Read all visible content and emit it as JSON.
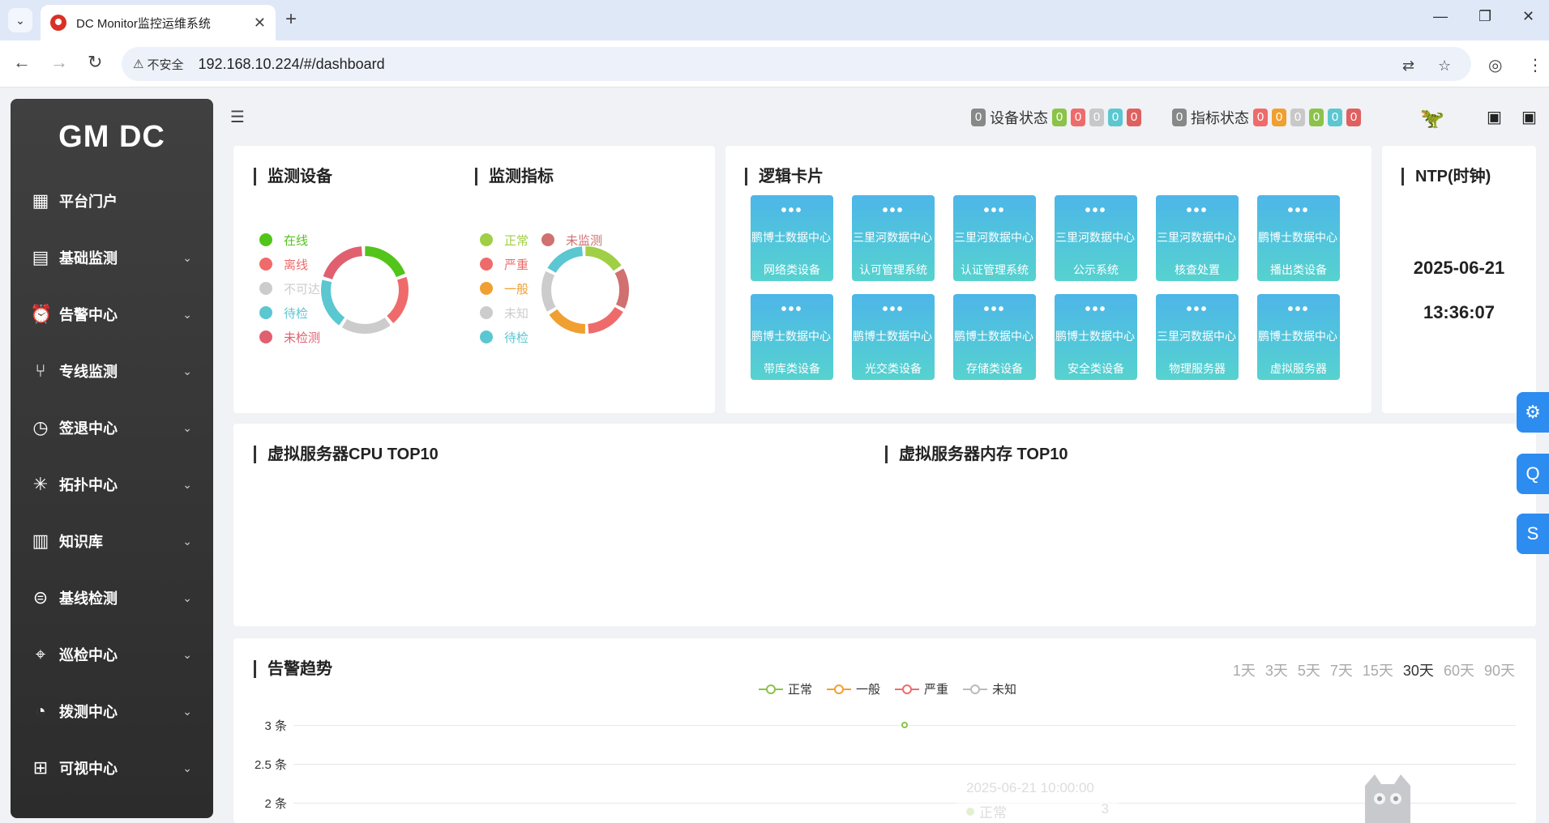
{
  "browser": {
    "tab_title": "DC Monitor监控运维系统",
    "insecure_label": "不安全",
    "url": "192.168.10.224/#/dashboard"
  },
  "sidebar": {
    "logo": "GM DC",
    "items": [
      {
        "label": "平台门户",
        "icon": "grid-icon"
      },
      {
        "label": "基础监测",
        "icon": "monitor-icon"
      },
      {
        "label": "告警中心",
        "icon": "alarm-icon"
      },
      {
        "label": "专线监测",
        "icon": "route-icon"
      },
      {
        "label": "签退中心",
        "icon": "clock-icon"
      },
      {
        "label": "拓扑中心",
        "icon": "topology-icon"
      },
      {
        "label": "知识库",
        "icon": "book-icon"
      },
      {
        "label": "基线检测",
        "icon": "baseline-icon"
      },
      {
        "label": "巡检中心",
        "icon": "location-icon"
      },
      {
        "label": "拨测中心",
        "icon": "dial-icon"
      },
      {
        "label": "可视中心",
        "icon": "windows-icon"
      }
    ]
  },
  "header": {
    "device_status": {
      "label": "设备状态",
      "total": "0",
      "pills": [
        {
          "value": "0",
          "color": "#8bc34a"
        },
        {
          "value": "0",
          "color": "#ef6b6b"
        },
        {
          "value": "0",
          "color": "#c8c8c8"
        },
        {
          "value": "0",
          "color": "#5bc7d0"
        },
        {
          "value": "0",
          "color": "#e06060"
        }
      ]
    },
    "metric_status": {
      "label": "指标状态",
      "total": "0",
      "pills": [
        {
          "value": "0",
          "color": "#ef6b6b"
        },
        {
          "value": "0",
          "color": "#f0a030"
        },
        {
          "value": "0",
          "color": "#c8c8c8"
        },
        {
          "value": "0",
          "color": "#8bc34a"
        },
        {
          "value": "0",
          "color": "#5bc7d0"
        },
        {
          "value": "0",
          "color": "#e06060"
        }
      ]
    }
  },
  "devices": {
    "title": "监测设备",
    "legend": [
      {
        "label": "在线",
        "color": "#52c41a"
      },
      {
        "label": "离线",
        "color": "#ef6b6b"
      },
      {
        "label": "不可达",
        "color": "#cccccc"
      },
      {
        "label": "待检",
        "color": "#5bc7d0"
      },
      {
        "label": "未检测",
        "color": "#e06070"
      }
    ]
  },
  "metrics": {
    "title": "监测指标",
    "legend": [
      {
        "label": "正常",
        "color": "#a0cf45"
      },
      {
        "label": "未监测",
        "color": "#d07070"
      },
      {
        "label": "严重",
        "color": "#ef6b6b"
      },
      {
        "label": "一般",
        "color": "#f0a030"
      },
      {
        "label": "未知",
        "color": "#cccccc"
      },
      {
        "label": "待检",
        "color": "#5bc7d0"
      }
    ]
  },
  "logic_cards": {
    "title": "逻辑卡片",
    "cards": [
      {
        "line1": "鹏博士数据中心",
        "line2": "网络类设备"
      },
      {
        "line1": "三里河数据中心",
        "line2": "认可管理系统"
      },
      {
        "line1": "三里河数据中心",
        "line2": "认证管理系统"
      },
      {
        "line1": "三里河数据中心",
        "line2": "公示系统"
      },
      {
        "line1": "三里河数据中心",
        "line2": "核查处置"
      },
      {
        "line1": "鹏博士数据中心",
        "line2": "播出类设备"
      },
      {
        "line1": "鹏博士数据中心",
        "line2": "带库类设备"
      },
      {
        "line1": "鹏博士数据中心",
        "line2": "光交类设备"
      },
      {
        "line1": "鹏博士数据中心",
        "line2": "存储类设备"
      },
      {
        "line1": "鹏博士数据中心",
        "line2": "安全类设备"
      },
      {
        "line1": "三里河数据中心",
        "line2": "物理服务器"
      },
      {
        "line1": "鹏博士数据中心",
        "line2": "虚拟服务器"
      }
    ]
  },
  "ntp": {
    "title": "NTP(时钟)",
    "date": "2025-06-21",
    "time": "13:36:07"
  },
  "top10": {
    "cpu_title": "虚拟服务器CPU TOP10",
    "mem_title": "虚拟服务器内存 TOP10"
  },
  "float_buttons": [
    "⚙",
    "Q",
    "S"
  ],
  "trend": {
    "title": "告警趋势",
    "ranges": [
      "1天",
      "3天",
      "5天",
      "7天",
      "15天",
      "30天",
      "60天",
      "90天"
    ],
    "active_range": "30天",
    "legend": [
      {
        "label": "正常",
        "color": "#8bc34a"
      },
      {
        "label": "一般",
        "color": "#f0a030"
      },
      {
        "label": "严重",
        "color": "#ef6b6b"
      },
      {
        "label": "未知",
        "color": "#bbbbbb"
      }
    ],
    "y_ticks": [
      "3 条",
      "2.5 条",
      "2 条"
    ],
    "tooltip": {
      "time": "2025-06-21 10:00:00",
      "series": "正常",
      "value": "3"
    }
  }
}
